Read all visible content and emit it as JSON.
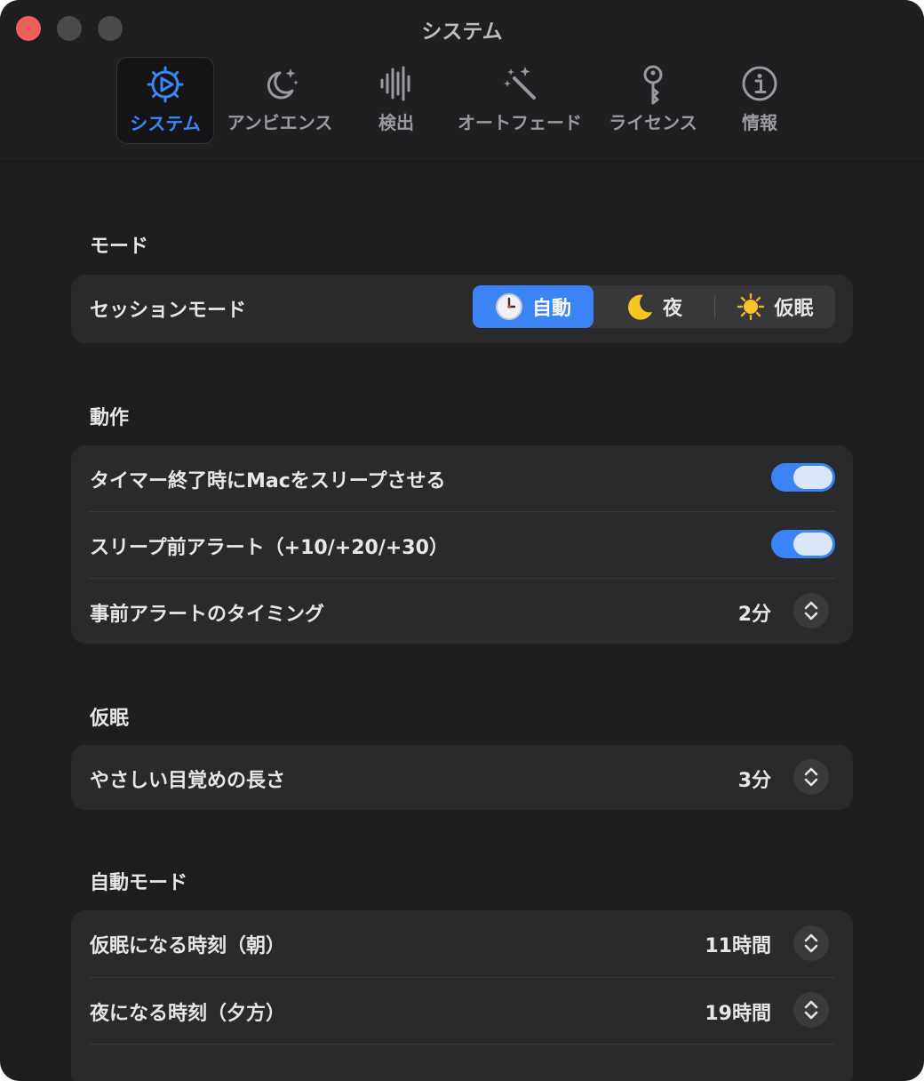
{
  "window": {
    "title": "システム"
  },
  "toolbar": {
    "tabs": [
      {
        "label": "システム",
        "icon": "gear-play-icon",
        "active": true
      },
      {
        "label": "アンビエンス",
        "icon": "moon-stars-icon",
        "active": false
      },
      {
        "label": "検出",
        "icon": "waveform-icon",
        "active": false
      },
      {
        "label": "オートフェード",
        "icon": "magic-wand-icon",
        "active": false
      },
      {
        "label": "ライセンス",
        "icon": "key-icon",
        "active": false
      },
      {
        "label": "情報",
        "icon": "info-circle-icon",
        "active": false
      }
    ]
  },
  "sections": {
    "mode": {
      "title": "モード",
      "session_mode": {
        "label": "セッションモード",
        "options": [
          {
            "label": "自動",
            "icon": "clock-emoji-icon",
            "selected": true
          },
          {
            "label": "夜",
            "icon": "crescent-moon-emoji-icon",
            "selected": false
          },
          {
            "label": "仮眠",
            "icon": "sun-emoji-icon",
            "selected": false
          }
        ]
      }
    },
    "behavior": {
      "title": "動作",
      "sleep_mac": {
        "label": "タイマー終了時にMacをスリープさせる",
        "on": true
      },
      "pre_alert": {
        "label": "スリープ前アラート（+10/+20/+30）",
        "on": true
      },
      "alert_timing": {
        "label": "事前アラートのタイミング",
        "value": "2分"
      }
    },
    "nap": {
      "title": "仮眠",
      "gentle_wake": {
        "label": "やさしい目覚めの長さ",
        "value": "3分"
      }
    },
    "auto_mode": {
      "title": "自動モード",
      "nap_time": {
        "label": "仮眠になる時刻（朝）",
        "value": "11時間"
      },
      "night_time": {
        "label": "夜になる時刻（夕方）",
        "value": "19時間"
      }
    }
  },
  "colors": {
    "accent": "#3a84f5",
    "window_bg": "#1e1e20",
    "group_bg": "#2a2a2c",
    "close_button": "#ec5f5a"
  }
}
